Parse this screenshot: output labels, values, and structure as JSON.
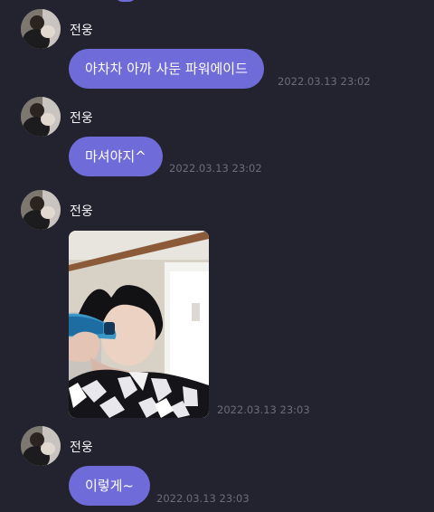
{
  "chat": {
    "messages": [
      {
        "sender": "전웅",
        "type": "text",
        "text": "아차차 아까 사둔 파워에이드",
        "time": "2022.03.13 23:02"
      },
      {
        "sender": "전웅",
        "type": "text",
        "text": "마셔야지^",
        "time": "2022.03.13 23:02"
      },
      {
        "sender": "전웅",
        "type": "image",
        "time": "2022.03.13 23:03"
      },
      {
        "sender": "전웅",
        "type": "text",
        "text": "이렇게~",
        "time": "2022.03.13 23:03"
      }
    ]
  },
  "theme": {
    "background": "#23232f",
    "bubble": "#6f6bd8",
    "bubble_text": "#ffffff",
    "sender_text": "#f4f4f8",
    "timestamp": "#6c6c78"
  },
  "icons": {
    "avatar": "profile-photo-avatar",
    "photo": "photo-attachment"
  }
}
